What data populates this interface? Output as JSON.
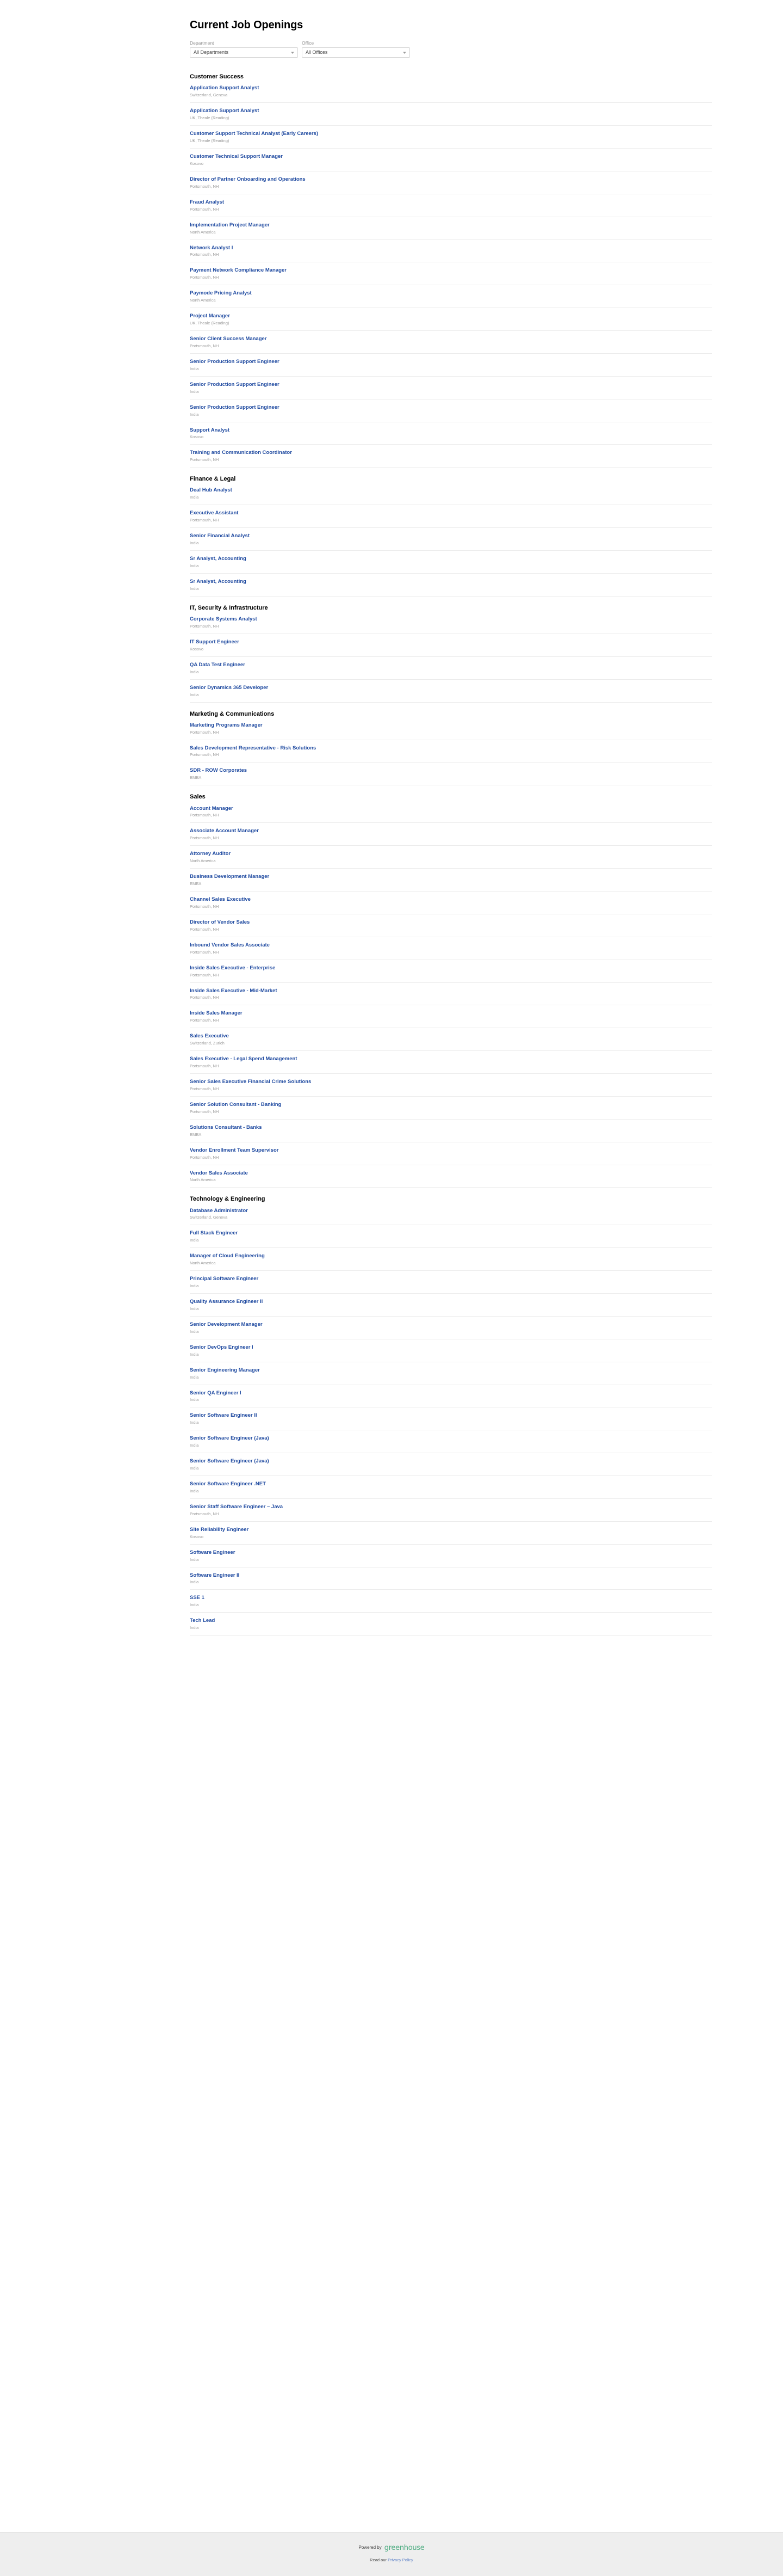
{
  "header": {
    "title": "Current Job Openings"
  },
  "filters": {
    "department": {
      "label": "Department",
      "selected": "All Departments"
    },
    "office": {
      "label": "Office",
      "selected": "All Offices"
    }
  },
  "departments": [
    {
      "name": "Customer Success",
      "jobs": [
        {
          "title": "Application Support Analyst",
          "location": "Switzerland, Geneva"
        },
        {
          "title": "Application Support Analyst",
          "location": "UK, Theale (Reading)"
        },
        {
          "title": "Customer Support Technical Analyst (Early Careers)",
          "location": "UK, Theale (Reading)"
        },
        {
          "title": "Customer Technical Support Manager",
          "location": "Kosovo"
        },
        {
          "title": "Director of Partner Onboarding and Operations",
          "location": "Portsmouth, NH"
        },
        {
          "title": "Fraud Analyst",
          "location": "Portsmouth, NH"
        },
        {
          "title": "Implementation Project Manager",
          "location": "North America"
        },
        {
          "title": "Network Analyst I",
          "location": "Portsmouth, NH"
        },
        {
          "title": "Payment Network Compliance Manager",
          "location": "Portsmouth, NH"
        },
        {
          "title": "Paymode Pricing Analyst",
          "location": "North America"
        },
        {
          "title": "Project Manager",
          "location": "UK, Theale (Reading)"
        },
        {
          "title": "Senior Client Success Manager",
          "location": "Portsmouth, NH"
        },
        {
          "title": "Senior Production Support Engineer",
          "location": "India"
        },
        {
          "title": "Senior Production Support Engineer",
          "location": "India"
        },
        {
          "title": "Senior Production Support Engineer",
          "location": "India"
        },
        {
          "title": "Support Analyst",
          "location": "Kosovo"
        },
        {
          "title": "Training and Communication Coordinator",
          "location": "Portsmouth, NH"
        }
      ]
    },
    {
      "name": "Finance & Legal",
      "jobs": [
        {
          "title": "Deal Hub Analyst",
          "location": "India"
        },
        {
          "title": "Executive Assistant",
          "location": "Portsmouth, NH"
        },
        {
          "title": "Senior Financial Analyst",
          "location": "India"
        },
        {
          "title": "Sr Analyst, Accounting",
          "location": "India"
        },
        {
          "title": "Sr Analyst, Accounting",
          "location": "India"
        }
      ]
    },
    {
      "name": "IT, Security & Infrastructure",
      "jobs": [
        {
          "title": "Corporate Systems Analyst",
          "location": "Portsmouth, NH"
        },
        {
          "title": "IT Support Engineer",
          "location": "Kosovo"
        },
        {
          "title": "QA Data Test Engineer",
          "location": "India"
        },
        {
          "title": "Senior Dynamics 365 Developer",
          "location": "India"
        }
      ]
    },
    {
      "name": "Marketing & Communications",
      "jobs": [
        {
          "title": "Marketing Programs Manager",
          "location": "Portsmouth, NH"
        },
        {
          "title": "Sales Development Representative - Risk Solutions",
          "location": "Portsmouth, NH"
        },
        {
          "title": "SDR - ROW Corporates",
          "location": "EMEA"
        }
      ]
    },
    {
      "name": "Sales",
      "jobs": [
        {
          "title": "Account Manager",
          "location": "Portsmouth, NH"
        },
        {
          "title": "Associate Account Manager",
          "location": "Portsmouth, NH"
        },
        {
          "title": "Attorney Auditor",
          "location": "North America"
        },
        {
          "title": "Business Development Manager",
          "location": "EMEA"
        },
        {
          "title": "Channel Sales Executive",
          "location": "Portsmouth, NH"
        },
        {
          "title": "Director of Vendor Sales",
          "location": "Portsmouth, NH"
        },
        {
          "title": "Inbound Vendor Sales Associate",
          "location": "Portsmouth, NH"
        },
        {
          "title": "Inside Sales Executive - Enterprise",
          "location": "Portsmouth, NH"
        },
        {
          "title": "Inside Sales Executive - Mid-Market",
          "location": "Portsmouth, NH"
        },
        {
          "title": "Inside Sales Manager",
          "location": "Portsmouth, NH"
        },
        {
          "title": "Sales Executive",
          "location": "Switzerland, Zurich"
        },
        {
          "title": "Sales Executive - Legal Spend Management",
          "location": "Portsmouth, NH"
        },
        {
          "title": "Senior Sales Executive Financial Crime Solutions",
          "location": "Portsmouth, NH"
        },
        {
          "title": "Senior Solution Consultant - Banking",
          "location": "Portsmouth, NH"
        },
        {
          "title": "Solutions Consultant - Banks",
          "location": "EMEA"
        },
        {
          "title": "Vendor Enrollment Team Supervisor",
          "location": "Portsmouth, NH"
        },
        {
          "title": "Vendor Sales Associate",
          "location": "North America"
        }
      ]
    },
    {
      "name": "Technology & Engineering",
      "jobs": [
        {
          "title": "Database Administrator",
          "location": "Switzerland, Geneva"
        },
        {
          "title": "Full Stack Engineer",
          "location": "India"
        },
        {
          "title": "Manager of Cloud Engineering",
          "location": "North America"
        },
        {
          "title": "Principal Software Engineer",
          "location": "India"
        },
        {
          "title": "Quality Assurance Engineer II",
          "location": "India"
        },
        {
          "title": "Senior Development Manager",
          "location": "India"
        },
        {
          "title": "Senior DevOps Engineer I",
          "location": "India"
        },
        {
          "title": "Senior Engineering Manager",
          "location": "India"
        },
        {
          "title": "Senior QA Engineer I",
          "location": "India"
        },
        {
          "title": "Senior Software Engineer II",
          "location": "India"
        },
        {
          "title": "Senior Software Engineer (Java)",
          "location": "India"
        },
        {
          "title": "Senior Software Engineer (Java)",
          "location": "India"
        },
        {
          "title": "Senior Software Engineer .NET",
          "location": "India"
        },
        {
          "title": "Senior Staff Software Engineer – Java",
          "location": "Portsmouth, NH"
        },
        {
          "title": "Site Reliability Engineer",
          "location": "Kosovo"
        },
        {
          "title": "Software Engineer",
          "location": "India"
        },
        {
          "title": "Software Engineer II",
          "location": "India"
        },
        {
          "title": "SSE 1",
          "location": "India"
        },
        {
          "title": "Tech Lead",
          "location": "India"
        }
      ]
    }
  ],
  "footer": {
    "powered_by_text": "Powered by",
    "brand": "greenhouse",
    "privacy_prefix": "Read our",
    "privacy_link": "Privacy Policy"
  },
  "colors": {
    "link": "#1f4aa0",
    "brand_green": "#4aab7f",
    "muted": "#9b9b9b"
  }
}
